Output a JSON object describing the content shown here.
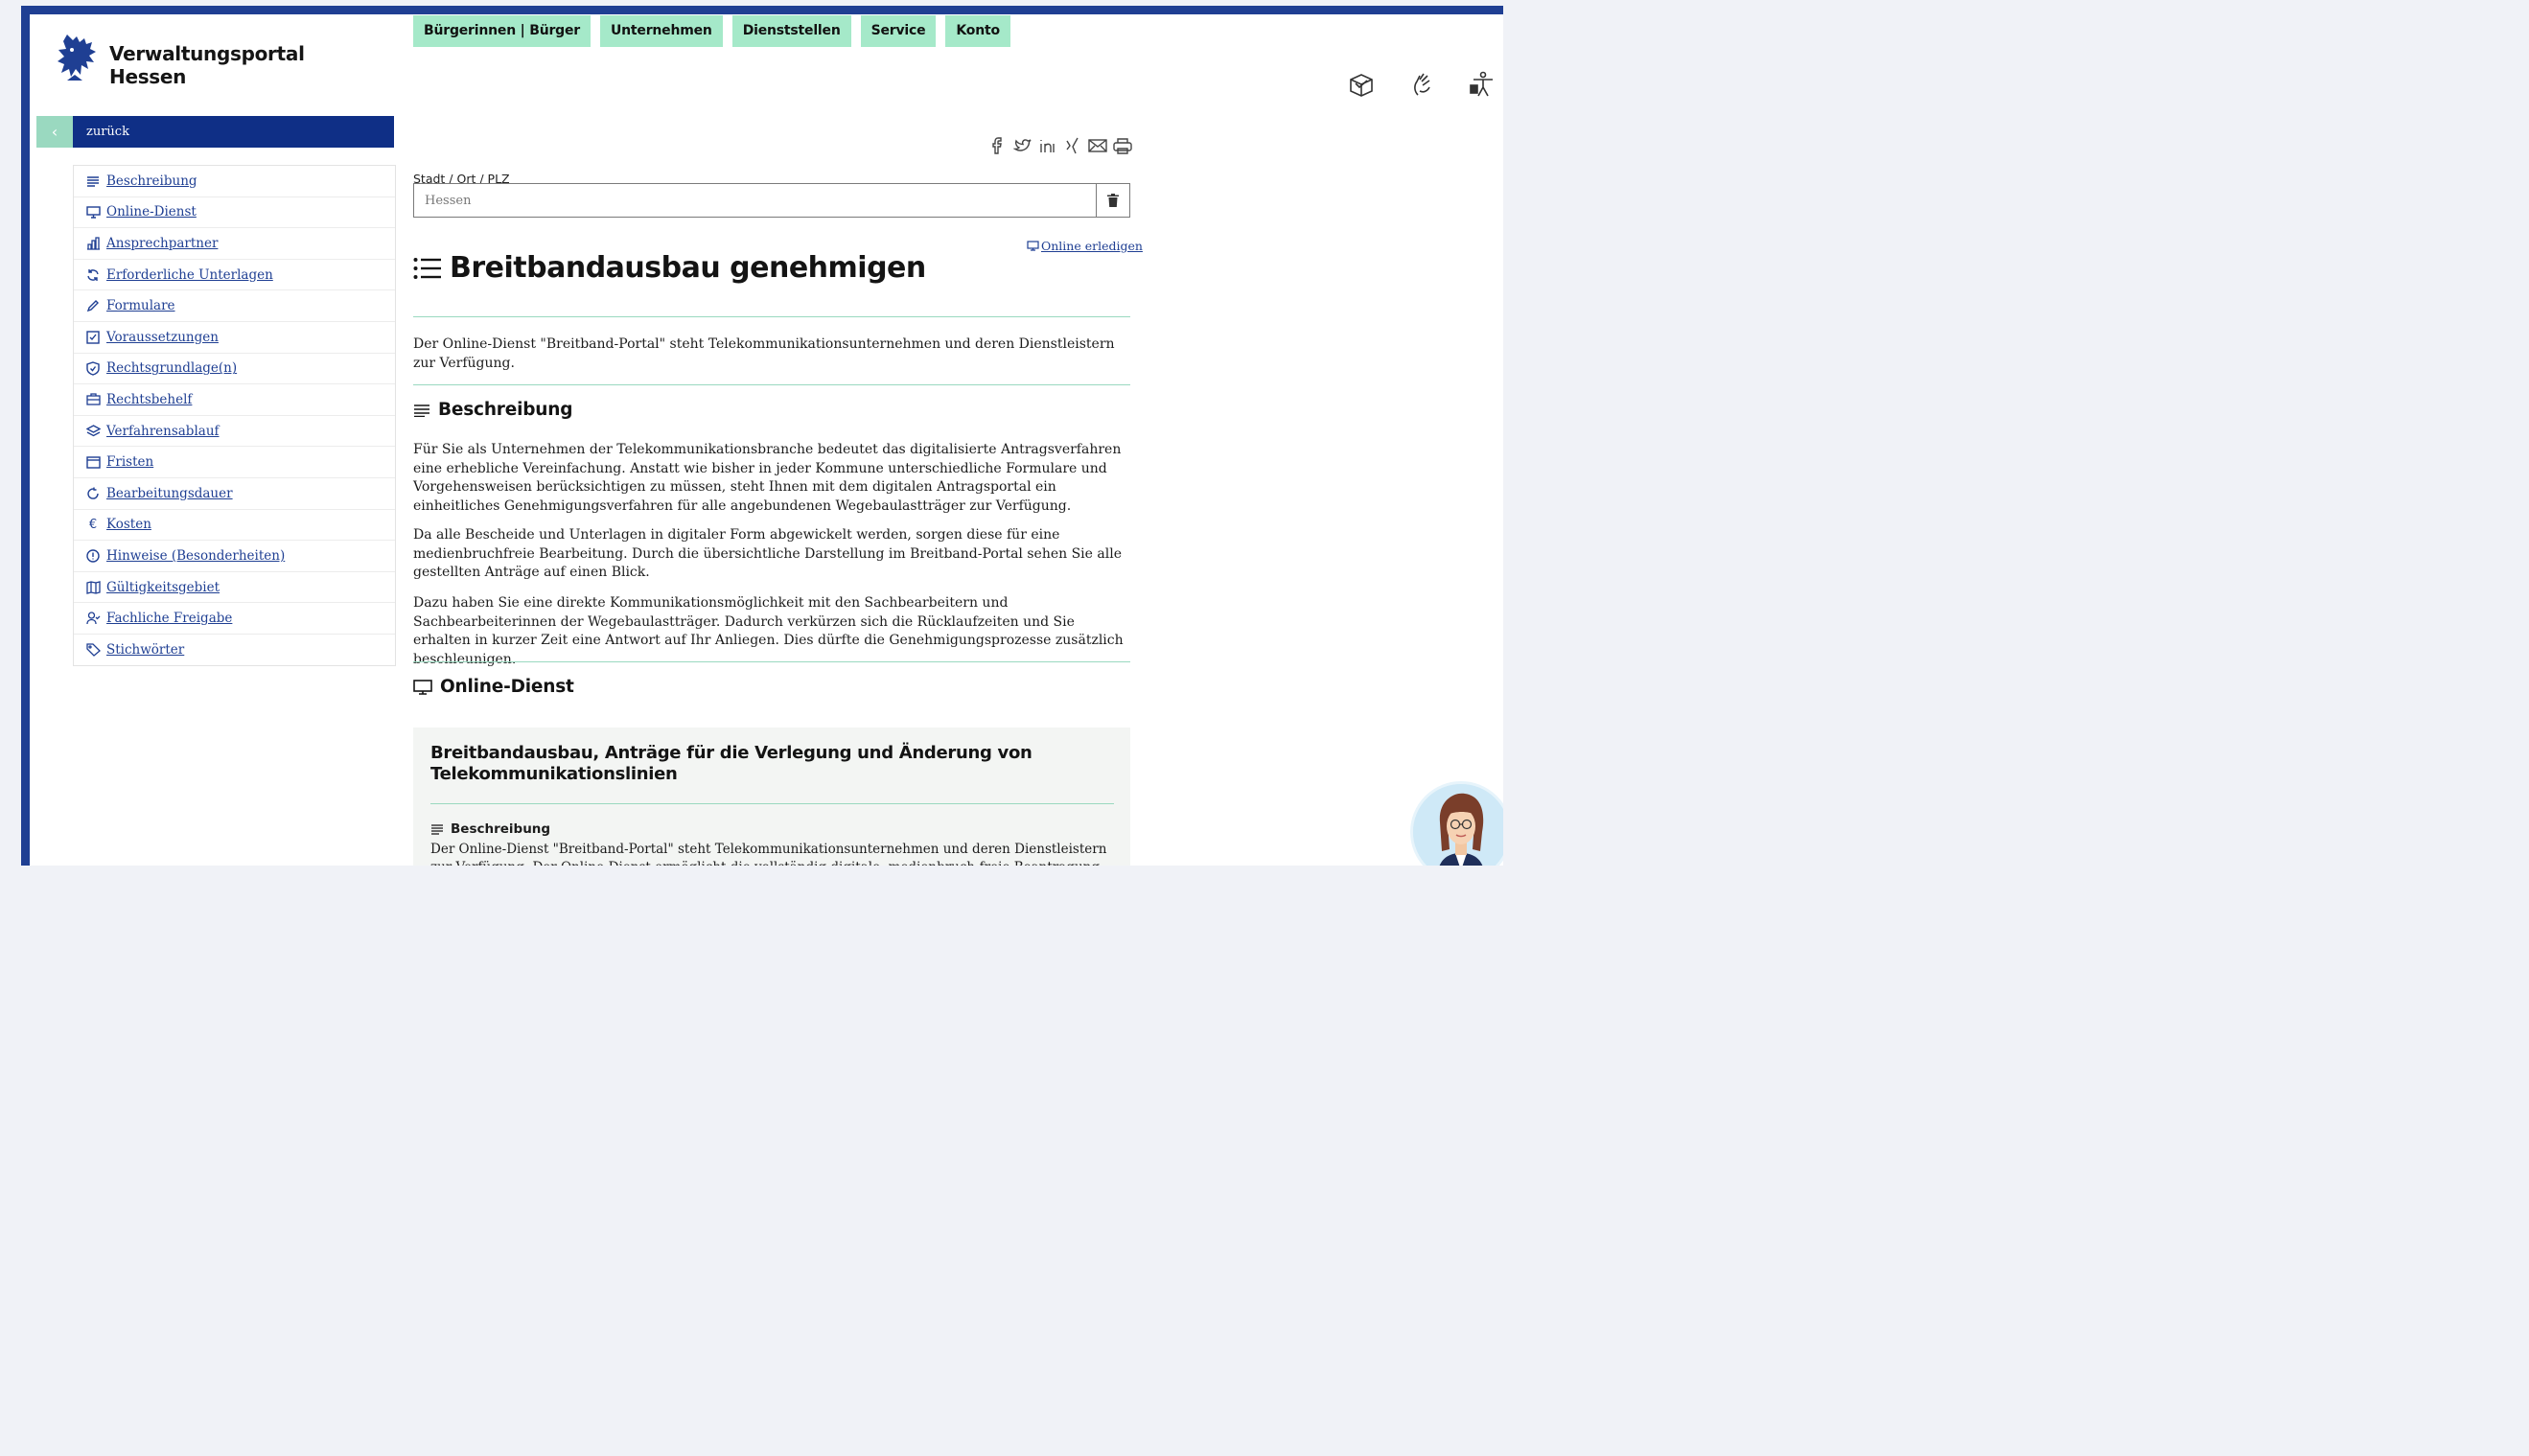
{
  "brand": {
    "line1": "Verwaltungsportal",
    "line2": "Hessen"
  },
  "nav": [
    "Bürgerinnen | Bürger",
    "Unternehmen",
    "Dienststellen",
    "Service",
    "Konto"
  ],
  "sidebar": {
    "back_label": "zurück",
    "items": [
      {
        "label": "Beschreibung",
        "icon": "lines-icon"
      },
      {
        "label": "Online-Dienst",
        "icon": "monitor-icon"
      },
      {
        "label": "Ansprechpartner",
        "icon": "building-icon"
      },
      {
        "label": "Erforderliche Unterlagen",
        "icon": "refresh-icon"
      },
      {
        "label": "Formulare",
        "icon": "pencil-icon"
      },
      {
        "label": "Voraussetzungen",
        "icon": "checkbox-icon"
      },
      {
        "label": "Rechtsgrundlage(n)",
        "icon": "shield-icon"
      },
      {
        "label": "Rechtsbehelf",
        "icon": "briefcase-icon"
      },
      {
        "label": "Verfahrensablauf",
        "icon": "layers-icon"
      },
      {
        "label": "Fristen",
        "icon": "calendar-icon"
      },
      {
        "label": "Bearbeitungsdauer",
        "icon": "rotate-icon"
      },
      {
        "label": "Kosten",
        "icon": "euro-icon"
      },
      {
        "label": "Hinweise (Besonderheiten)",
        "icon": "info-icon"
      },
      {
        "label": "Gültigkeitsgebiet",
        "icon": "map-icon"
      },
      {
        "label": "Fachliche Freigabe",
        "icon": "user-check-icon"
      },
      {
        "label": "Stichwörter",
        "icon": "tag-icon"
      }
    ]
  },
  "location": {
    "label": "Stadt / Ort / PLZ",
    "value": "Hessen"
  },
  "online_link": "Online erledigen",
  "page": {
    "title": "Breitbandausbau genehmigen",
    "intro": "Der Online-Dienst \"Breitband-Portal\" steht Telekommunikationsunternehmen und deren Dienstleistern zur Verfügung.",
    "section1_title": "Beschreibung",
    "paragraphs": [
      "Für Sie als Unternehmen der Telekommunikationsbranche bedeutet das digitalisierte Antragsverfahren eine erhebliche Vereinfachung. Anstatt wie bisher in jeder Kommune unterschiedliche Formulare und Vorgehensweisen berücksichtigen zu müssen, steht Ihnen mit dem digitalen Antragsportal ein einheitliches Genehmigungsverfahren für alle angebundenen Wegebaulastträger zur Verfügung.",
      "Da alle Bescheide und Unterlagen in digitaler Form abgewickelt werden, sorgen diese für eine medienbruchfreie Bearbeitung. Durch die übersichtliche Darstellung im Breitband-Portal sehen Sie alle gestellten Anträge auf einen Blick.",
      "Dazu haben Sie eine direkte Kommunikationsmöglichkeit mit den Sachbearbeitern und Sachbearbeiterinnen der Wegebaulastträger. Dadurch verkürzen sich die Rücklaufzeiten und Sie erhalten in kurzer Zeit eine Antwort auf Ihr Anliegen. Dies dürfte die Genehmigungsprozesse zusätzlich beschleunigen."
    ],
    "section2_title": "Online-Dienst",
    "card": {
      "title": "Breitbandausbau, Anträge für die Verlegung und Änderung von Telekommunikationslinien",
      "sub_title": "Beschreibung",
      "text": "Der Online-Dienst \"Breitband-Portal\" steht Telekommunikationsunternehmen und deren Dienstleistern zur Verfügung. Der Online-Dienst ermöglicht die vollständig digitale, medienbruch-freie Beantragung und"
    }
  },
  "colors": {
    "accent_green": "#a5e9c9",
    "navy": "#0f2f86",
    "frame": "#1f3f93",
    "rule": "#9ad9c0"
  }
}
